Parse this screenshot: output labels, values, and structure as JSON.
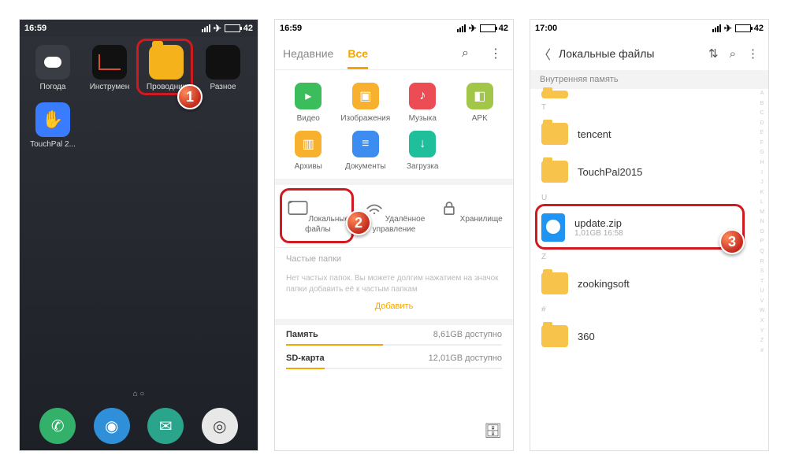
{
  "phone1": {
    "time": "16:59",
    "battery": "42",
    "apps": {
      "weather": "Погода",
      "tools": "Инструмен",
      "explorer": "Проводник",
      "misc": "Разное",
      "touchpal": "TouchPal 2..."
    },
    "marker": "1"
  },
  "phone2": {
    "time": "16:59",
    "battery": "42",
    "tabs": {
      "recent": "Недавние",
      "all": "Все"
    },
    "categories": {
      "video": "Видео",
      "images": "Изображения",
      "music": "Музыка",
      "apk": "APK",
      "archives": "Архивы",
      "docs": "Документы",
      "download": "Загрузка"
    },
    "locations": {
      "local": "Локальные файлы",
      "remote": "Удалённое управление",
      "vault": "Хранилище"
    },
    "frequent": {
      "title": "Частые папки",
      "empty": "Нет частых папок. Вы можете долгим нажатием на значок папки добавить её к частым папкам",
      "add": "Добавить"
    },
    "storage": {
      "memory_label": "Память",
      "memory_value": "8,61GB доступно",
      "memory_fill": "45%",
      "sd_label": "SD-карта",
      "sd_value": "12,01GB доступно",
      "sd_fill": "18%"
    },
    "marker": "2"
  },
  "phone3": {
    "time": "17:00",
    "battery": "42",
    "title": "Локальные файлы",
    "breadcrumb": "Внутренняя память",
    "letters": {
      "t": "T",
      "u": "U",
      "z": "Z",
      "hash": "#"
    },
    "items": {
      "tencent": "tencent",
      "touchpal": "TouchPal2015",
      "update_name": "update.zip",
      "update_sub": "1,01GB   16:58",
      "zooking": "zookingsoft",
      "n360": "360"
    },
    "index": [
      "A",
      "B",
      "C",
      "D",
      "E",
      "F",
      "G",
      "H",
      "I",
      "J",
      "K",
      "L",
      "M",
      "N",
      "O",
      "P",
      "Q",
      "R",
      "S",
      "T",
      "U",
      "V",
      "W",
      "X",
      "Y",
      "Z",
      "#"
    ],
    "marker": "3"
  }
}
